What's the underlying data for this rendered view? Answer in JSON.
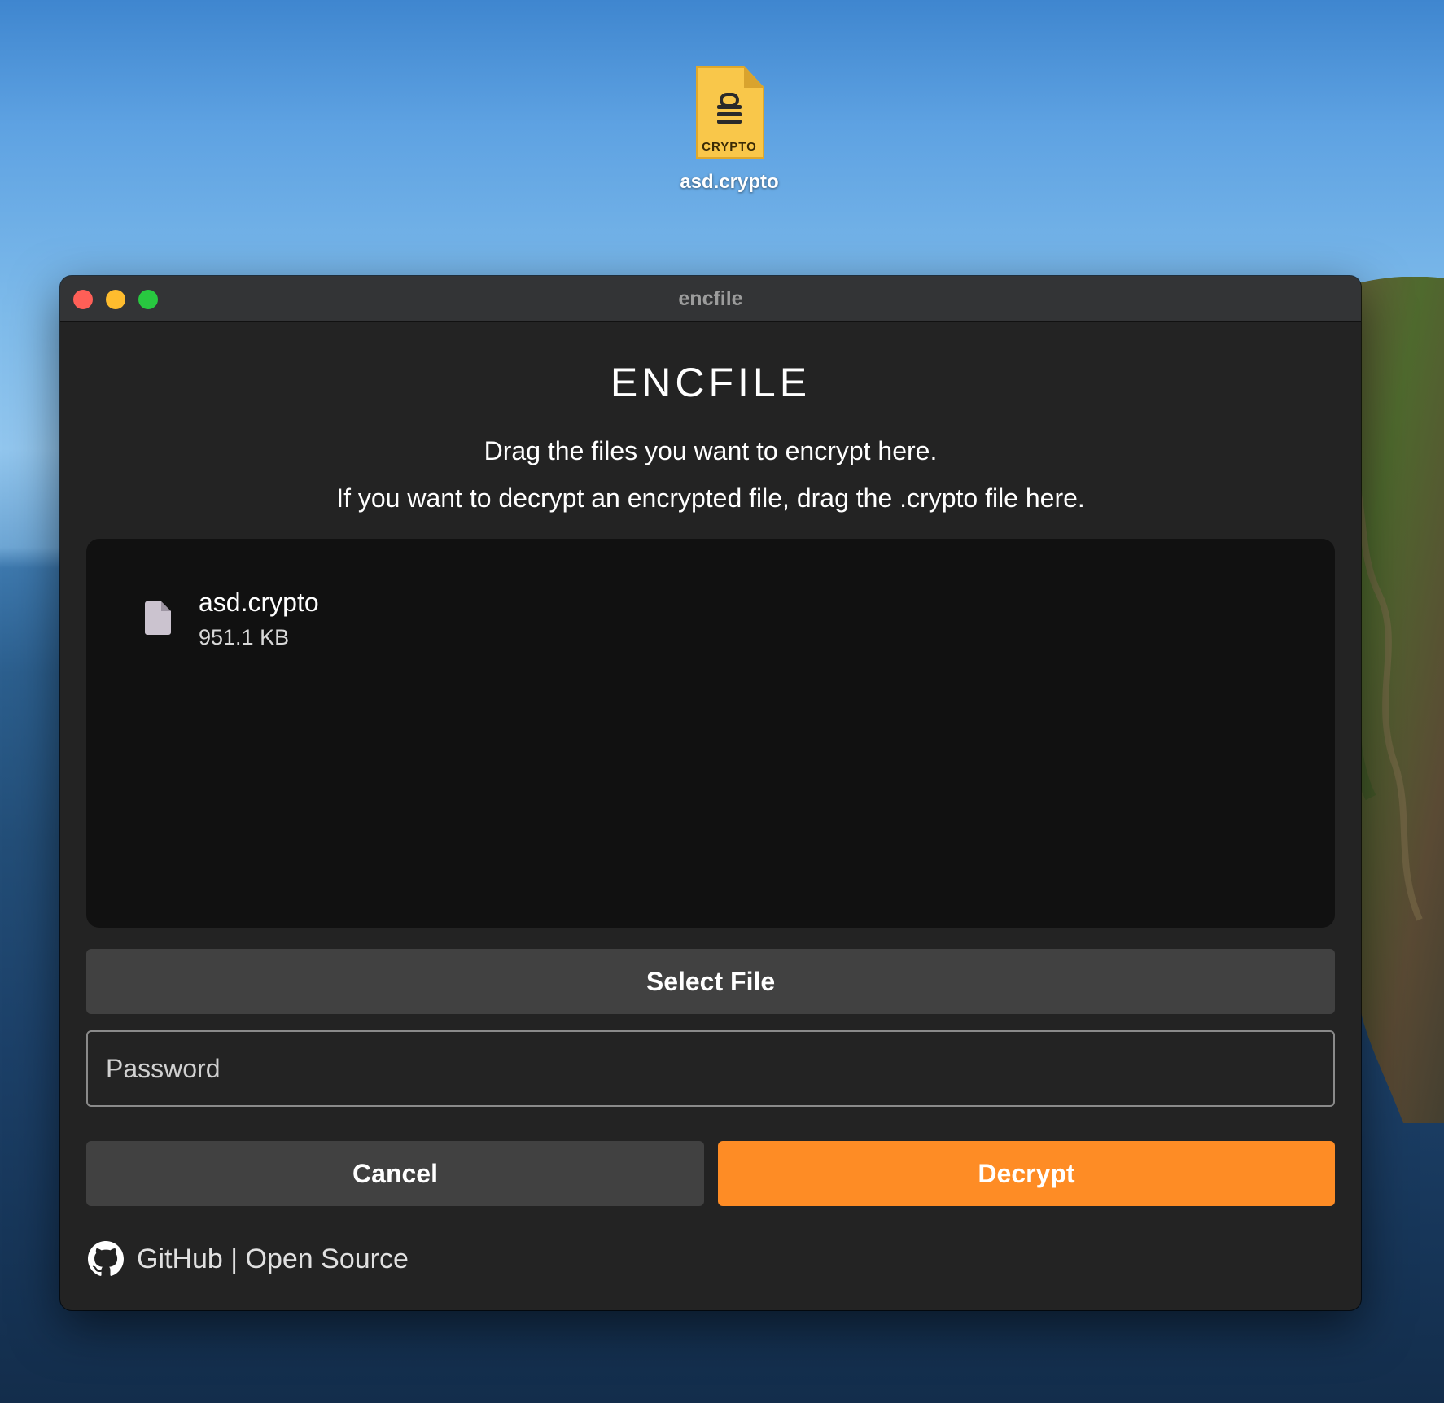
{
  "desktop": {
    "icon": {
      "name": "asd.crypto",
      "doc_label": "CRYPTO",
      "icon": "encrypted-document-icon",
      "color": "#f9c74a"
    }
  },
  "window": {
    "title": "encfile",
    "controls": [
      "close",
      "minimize",
      "zoom"
    ]
  },
  "main": {
    "app_title": "ENCFILE",
    "instruction_1": "Drag the files you want to encrypt here.",
    "instruction_2": "If you want to decrypt an encrypted file, drag the .crypto file here.",
    "files": [
      {
        "name": "asd.crypto",
        "size": "951.1 KB",
        "icon": "file-icon"
      }
    ],
    "select_file_label": "Select File",
    "password": {
      "value": "",
      "placeholder": "Password"
    },
    "cancel_label": "Cancel",
    "decrypt_label": "Decrypt",
    "footer_link": "GitHub | Open Source",
    "footer_icon": "github-icon"
  },
  "colors": {
    "accent": "#fe8c25",
    "window_bg": "#232323",
    "dropzone_bg": "#111111",
    "button_bg": "#414141"
  }
}
